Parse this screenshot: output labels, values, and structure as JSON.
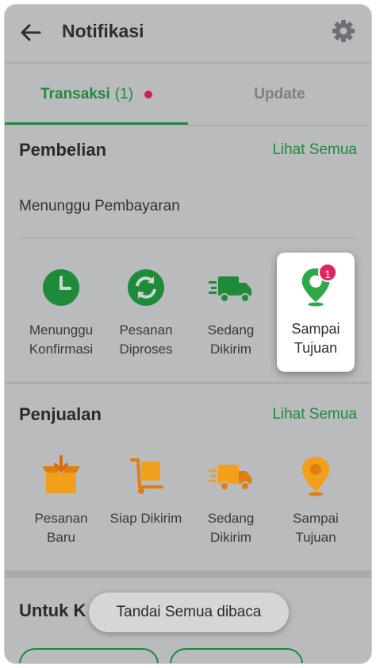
{
  "header": {
    "title": "Notifikasi"
  },
  "tabs": [
    {
      "label": "Transaksi",
      "count": "(1)"
    },
    {
      "label": "Update"
    }
  ],
  "pembelian": {
    "title": "Pembelian",
    "see_all": "Lihat Semua",
    "waiting_payment": "Menunggu Pembayaran",
    "items": [
      {
        "label": "Menunggu\nKonfirmasi",
        "icon": "clock-icon"
      },
      {
        "label": "Pesanan\nDiproses",
        "icon": "refresh-icon"
      },
      {
        "label": "Sedang\nDikirim",
        "icon": "truck-icon"
      },
      {
        "label": "Sampai\nTujuan",
        "icon": "location-pin-icon",
        "badge": "1"
      }
    ]
  },
  "penjualan": {
    "title": "Penjualan",
    "see_all": "Lihat Semua",
    "items": [
      {
        "label": "Pesanan\nBaru",
        "icon": "box-in-icon"
      },
      {
        "label": "Siap Dikirim",
        "icon": "cart-box-icon"
      },
      {
        "label": "Sedang\nDikirim",
        "icon": "truck-icon"
      },
      {
        "label": "Sampai\nTujuan",
        "icon": "location-pin-icon"
      }
    ]
  },
  "untuk_kamu": {
    "title_partial": "Untuk K"
  },
  "toast": {
    "label": "Tandai Semua dibaca"
  },
  "colors": {
    "accent": "#1f8a3a",
    "badge": "#e0245e",
    "orange": "#f2a01b",
    "overlay": "#b9bbbd"
  }
}
